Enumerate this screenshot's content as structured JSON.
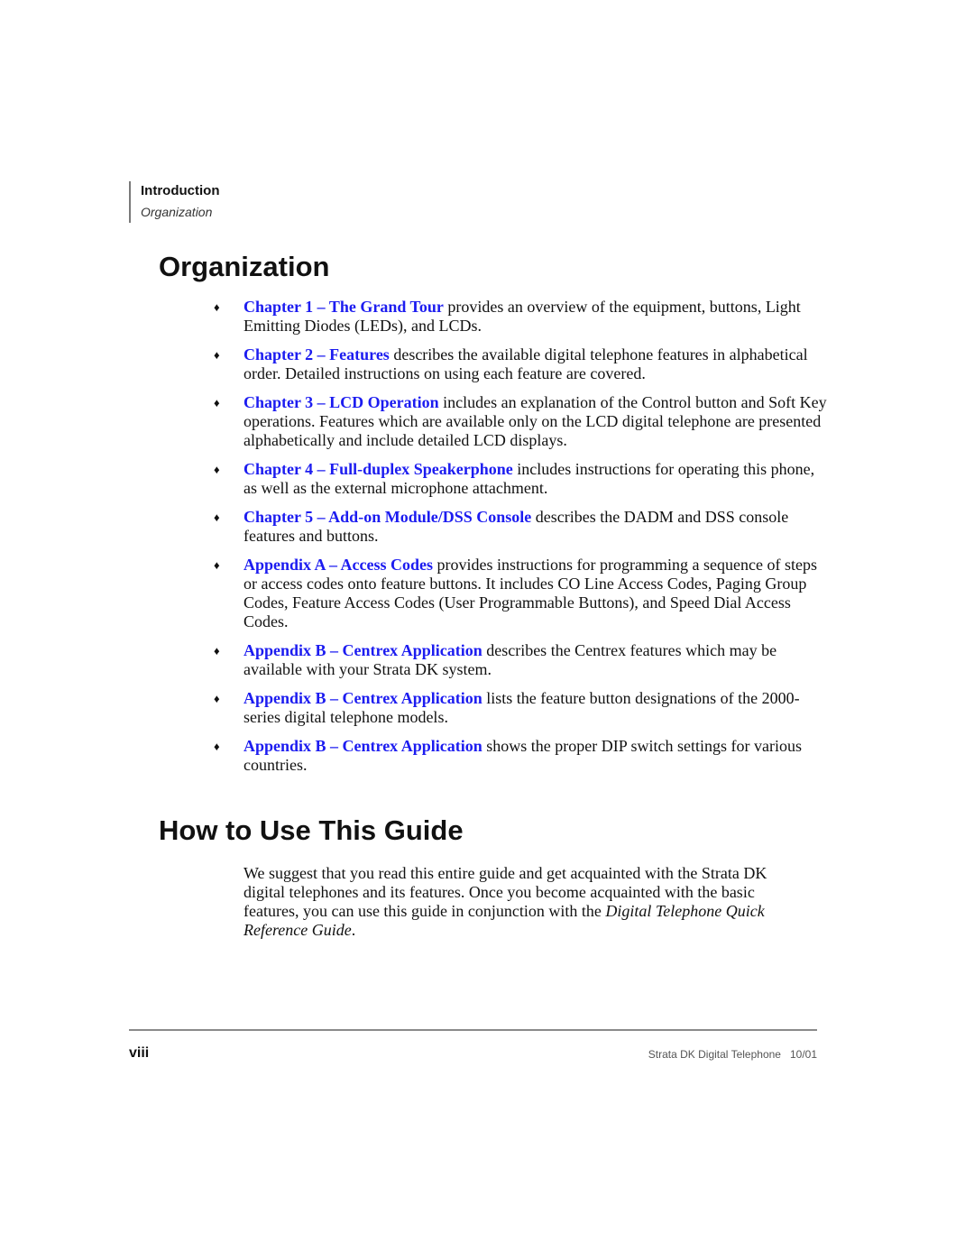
{
  "running_head": {
    "chapter": "Introduction",
    "section": "Organization"
  },
  "sections": {
    "organization": {
      "title": "Organization",
      "items": [
        {
          "link": "Chapter 1 – The Grand Tour",
          "text": " provides an overview of the equipment, buttons, Light Emitting Diodes (LEDs), and LCDs."
        },
        {
          "link": "Chapter 2 – Features",
          "text": " describes the available digital telephone features in alphabetical order. Detailed instructions on using each feature are covered."
        },
        {
          "link": "Chapter 3 – LCD Operation",
          "text": " includes an explanation of the Control button and Soft Key operations. Features which are available only on the LCD digital telephone are presented alphabetically and include detailed LCD displays."
        },
        {
          "link": "Chapter 4 – Full-duplex Speakerphone",
          "text": " includes instructions for operating this phone, as well as the external microphone attachment."
        },
        {
          "link": "Chapter 5 – Add-on Module/DSS Console",
          "text": " describes the DADM and DSS console features and buttons."
        },
        {
          "link": "Appendix A – Access Codes",
          "text": " provides instructions for programming a sequence of steps or access codes onto feature buttons. It includes CO Line Access Codes, Paging Group Codes, Feature Access Codes (User Programmable Buttons), and Speed Dial Access Codes."
        },
        {
          "link": "Appendix B – Centrex Application",
          "text": " describes the Centrex features which may be available with your Strata DK system."
        },
        {
          "link": "Appendix B – Centrex Application",
          "text": " lists the feature button designations of the 2000-series digital telephone models."
        },
        {
          "link": "Appendix B – Centrex Application",
          "text": " shows the proper DIP switch settings for various countries."
        }
      ],
      "bullet_glyph": "♦"
    },
    "how_to_use": {
      "title": "How to Use This Guide",
      "paragraph_pre": "We suggest that you read this entire guide and get acquainted with the Strata DK digital telephones and its features. Once you become acquainted with the basic features, you can use this guide in conjunction with the ",
      "paragraph_italic": "Digital Telephone Quick Reference Guide",
      "paragraph_post": "."
    }
  },
  "footer": {
    "page_number": "viii",
    "title": "Strata DK Digital Telephone   10/01"
  },
  "colors": {
    "link": "#1c1cf0",
    "text": "#111111",
    "rule": "#8a8a8a"
  }
}
